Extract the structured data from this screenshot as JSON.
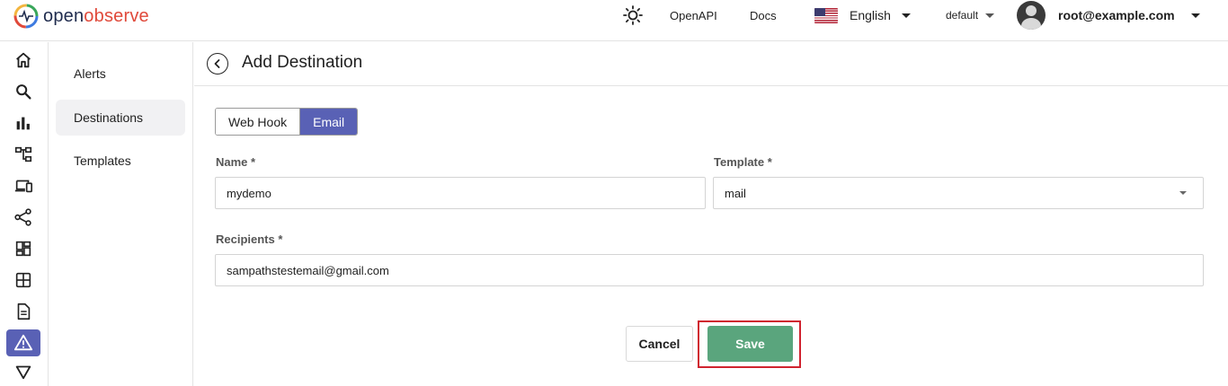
{
  "header": {
    "logo": {
      "prefix": "open",
      "suffix": "observe"
    },
    "openapi_label": "OpenAPI",
    "docs_label": "Docs",
    "language": "English",
    "org": "default",
    "user": "root@example.com"
  },
  "rail": {
    "icons": [
      "home-icon",
      "search-icon",
      "bar-chart-icon",
      "hierarchy-icon",
      "devices-icon",
      "share-icon",
      "dashboard-icon",
      "table-icon",
      "document-icon",
      "alert-icon",
      "filter-icon"
    ],
    "active": "alert-icon"
  },
  "subnav": {
    "items": [
      {
        "label": "Alerts"
      },
      {
        "label": "Destinations",
        "active": true
      },
      {
        "label": "Templates"
      }
    ]
  },
  "page": {
    "title": "Add Destination",
    "type_toggle": {
      "options": [
        "Web Hook",
        "Email"
      ],
      "selected": "Email"
    },
    "form": {
      "name": {
        "label": "Name *",
        "value": "mydemo"
      },
      "template": {
        "label": "Template *",
        "value": "mail"
      },
      "recipients": {
        "label": "Recipients *",
        "value": "sampathstestemail@gmail.com"
      }
    },
    "cancel_label": "Cancel",
    "save_label": "Save"
  },
  "colors": {
    "accent": "#5961b5",
    "save": "#5aa57d",
    "highlight": "#d0232f"
  }
}
